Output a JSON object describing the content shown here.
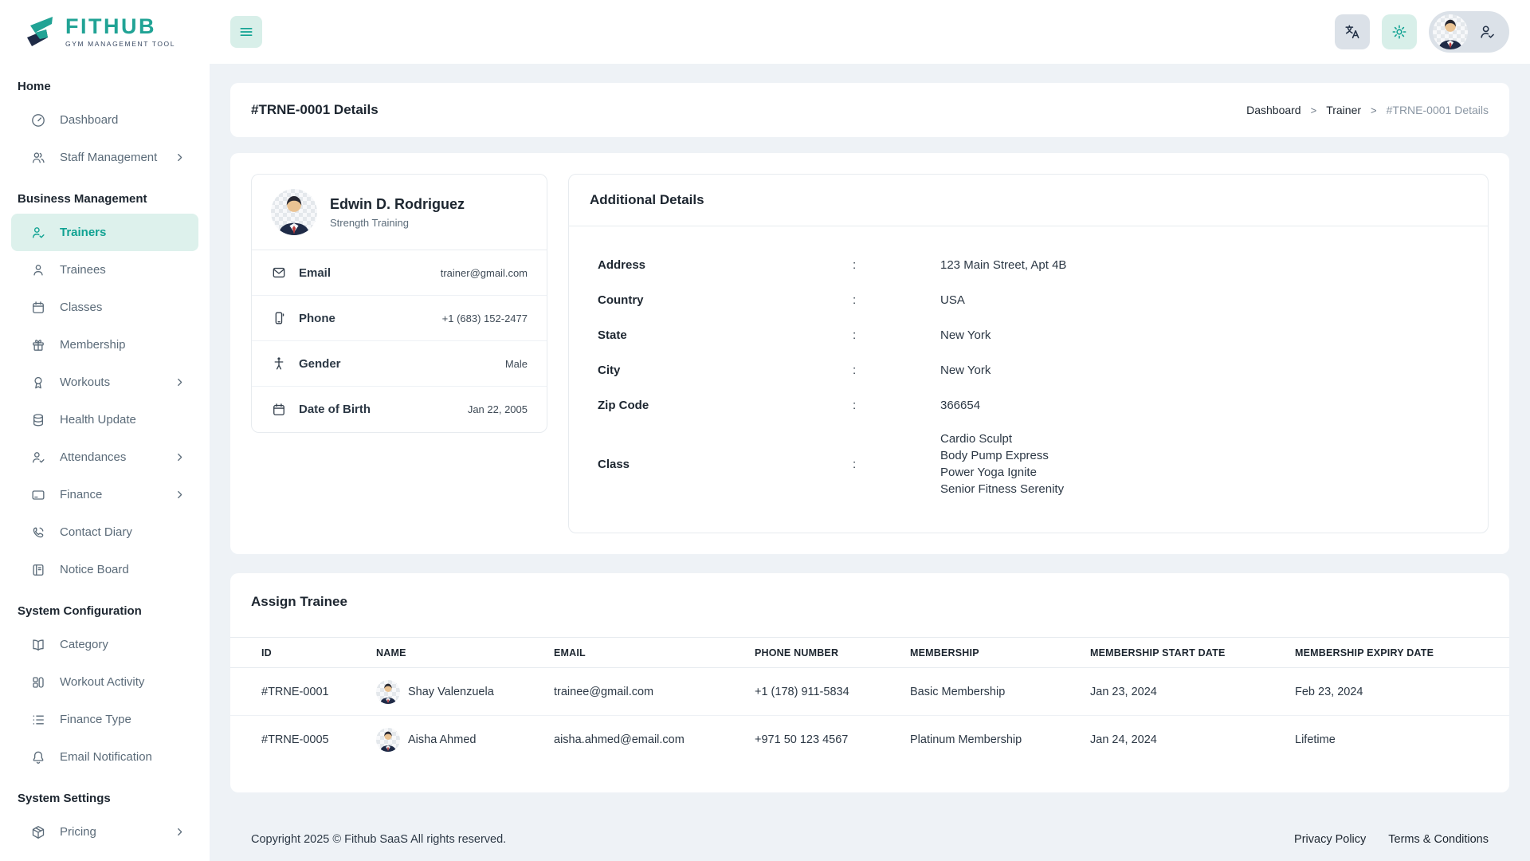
{
  "brand": {
    "name": "FITHUB",
    "tagline": "GYM MANAGEMENT TOOL"
  },
  "colors": {
    "accent": "#10a292",
    "accent_light": "#d8efe9",
    "navy": "#1f2b47",
    "tie_red": "#bf3a3a",
    "page_bg": "#eef2f6"
  },
  "header": {
    "menu_icon": "hamburger-menu",
    "translate_icon": "translate",
    "settings_icon": "gear",
    "profile_icons": [
      "male-avatar",
      "user-check"
    ]
  },
  "sidebar": {
    "sections": [
      {
        "title": "Home",
        "items": [
          {
            "label": "Dashboard",
            "icon": "gauge"
          },
          {
            "label": "Staff Management",
            "icon": "users",
            "expandable": true
          }
        ]
      },
      {
        "title": "Business Management",
        "items": [
          {
            "label": "Trainers",
            "icon": "user-check",
            "active": true
          },
          {
            "label": "Trainees",
            "icon": "user"
          },
          {
            "label": "Classes",
            "icon": "calendar"
          },
          {
            "label": "Membership",
            "icon": "gift"
          },
          {
            "label": "Workouts",
            "icon": "award",
            "expandable": true
          },
          {
            "label": "Health Update",
            "icon": "database"
          },
          {
            "label": "Attendances",
            "icon": "user-check",
            "expandable": true
          },
          {
            "label": "Finance",
            "icon": "credit-card",
            "expandable": true
          },
          {
            "label": "Contact Diary",
            "icon": "phone"
          },
          {
            "label": "Notice Board",
            "icon": "notebook"
          }
        ]
      },
      {
        "title": "System Configuration",
        "items": [
          {
            "label": "Category",
            "icon": "book-open"
          },
          {
            "label": "Workout Activity",
            "icon": "layout-grid"
          },
          {
            "label": "Finance Type",
            "icon": "list"
          },
          {
            "label": "Email Notification",
            "icon": "bell"
          }
        ]
      },
      {
        "title": "System Settings",
        "items": [
          {
            "label": "Pricing",
            "icon": "package",
            "expandable": true
          }
        ]
      }
    ]
  },
  "page": {
    "title": "#TRNE-0001 Details",
    "breadcrumb": [
      "Dashboard",
      "Trainer",
      "#TRNE-0001 Details"
    ],
    "breadcrumb_separator": ">"
  },
  "profile": {
    "name": "Edwin D. Rodriguez",
    "specialty": "Strength Training",
    "rows": [
      {
        "label": "Email",
        "value": "trainer@gmail.com",
        "icon": "mail"
      },
      {
        "label": "Phone",
        "value": "+1 (683) 152-2477",
        "icon": "smartphone"
      },
      {
        "label": "Gender",
        "value": "Male",
        "icon": "person-standing"
      },
      {
        "label": "Date of Birth",
        "value": "Jan 22, 2005",
        "icon": "calendar"
      }
    ]
  },
  "details": {
    "title": "Additional Details",
    "colon": ":",
    "rows": [
      {
        "label": "Address",
        "value": "123 Main Street, Apt 4B"
      },
      {
        "label": "Country",
        "value": "USA"
      },
      {
        "label": "State",
        "value": "New York"
      },
      {
        "label": "City",
        "value": "New York"
      },
      {
        "label": "Zip Code",
        "value": "366654"
      }
    ],
    "class_row": {
      "label": "Class",
      "values": [
        "Cardio Sculpt",
        "Body Pump Express",
        "Power Yoga Ignite",
        "Senior Fitness Serenity"
      ]
    }
  },
  "assign": {
    "title": "Assign Trainee",
    "columns": [
      "ID",
      "NAME",
      "EMAIL",
      "PHONE NUMBER",
      "MEMBERSHIP",
      "MEMBERSHIP START DATE",
      "MEMBERSHIP EXPIRY DATE"
    ],
    "rows": [
      {
        "id": "#TRNE-0001",
        "name": "Shay Valenzuela",
        "email": "trainee@gmail.com",
        "phone": "+1 (178) 911-5834",
        "membership": "Basic Membership",
        "start": "Jan 23, 2024",
        "expiry": "Feb 23, 2024"
      },
      {
        "id": "#TRNE-0005",
        "name": "Aisha Ahmed",
        "email": "aisha.ahmed@email.com",
        "phone": "+971 50 123 4567",
        "membership": "Platinum Membership",
        "start": "Jan 24, 2024",
        "expiry": "Lifetime"
      }
    ]
  },
  "footer": {
    "copyright": "Copyright 2025 © Fithub SaaS All rights reserved.",
    "links": [
      "Privacy Policy",
      "Terms & Conditions"
    ]
  }
}
